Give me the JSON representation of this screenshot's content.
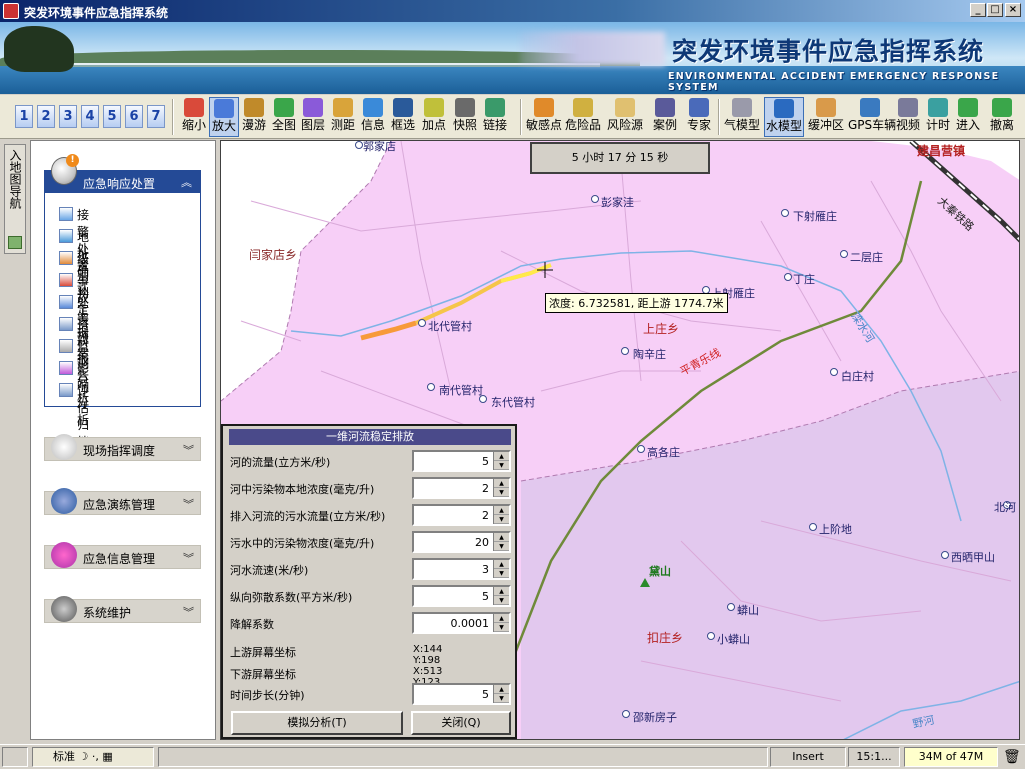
{
  "window": {
    "title": "突发环境事件应急指挥系统"
  },
  "banner": {
    "title": "突发环境事件应急指挥系统",
    "subtitle": "ENVIRONMENTAL ACCIDENT EMERGENCY RESPONSE SYSTEM"
  },
  "toolbar": {
    "numbers": [
      "1",
      "2",
      "3",
      "4",
      "5",
      "6",
      "7"
    ],
    "tools": [
      "缩小",
      "放大",
      "漫游",
      "全图",
      "图层",
      "测距",
      "信息",
      "框选",
      "加点",
      "快照",
      "链接"
    ],
    "tools2": [
      "敏感点",
      "危险品",
      "风险源",
      "案例",
      "专家"
    ],
    "tools3": [
      "气模型",
      "水模型",
      "缓冲区",
      "GPS车辆",
      "视频",
      "计时",
      "进入",
      "撤离"
    ],
    "active": [
      "放大",
      "水模型"
    ]
  },
  "left_tab": {
    "label": "入地图导航"
  },
  "sidebar": {
    "response": {
      "title": "应急响应处置",
      "items": [
        "接警处置",
        "地址确认",
        "级别判定",
        "事故上报",
        "处置预案",
        "资料报告",
        "监测分析",
        "影响分析",
        "评估归档"
      ]
    },
    "sections": [
      "现场指挥调度",
      "应急演练管理",
      "应急信息管理",
      "系统维护"
    ]
  },
  "map": {
    "timer": "5 小时 17 分 15 秒",
    "tooltip": "浓度: 6.732581, 距上游 1774.7米",
    "places": [
      "郭家店",
      "彭家洼",
      "下射雁庄",
      "二层庄",
      "丁庄",
      "上射雁庄",
      "闫家店乡",
      "北代管村",
      "上庄乡",
      "陶辛庄",
      "南代管村",
      "东代管村",
      "白庄村",
      "高各庄",
      "上阶地",
      "西晒甲山",
      "北河",
      "黛山",
      "蟒山",
      "小蟒山",
      "扣庄乡",
      "邵新房子",
      "建昌营镇",
      "大秦铁路",
      "平青乐线",
      "滦水河",
      "野河"
    ]
  },
  "dialog": {
    "title": "一维河流稳定排放",
    "fields": [
      {
        "label": "河的流量(立方米/秒)",
        "value": "5"
      },
      {
        "label": "河中污染物本地浓度(毫克/升)",
        "value": "2"
      },
      {
        "label": "排入河流的污水流量(立方米/秒)",
        "value": "2"
      },
      {
        "label": "污水中的污染物浓度(毫克/升)",
        "value": "20"
      },
      {
        "label": "河水流速(米/秒)",
        "value": "3"
      },
      {
        "label": "纵向弥散系数(平方米/秒)",
        "value": "5"
      },
      {
        "label": "降解系数",
        "value": "0.0001"
      }
    ],
    "upstream": {
      "label": "上游屏幕坐标",
      "value": "X:144 Y:198"
    },
    "downstream": {
      "label": "下游屏幕坐标",
      "value": "X:513 Y:123"
    },
    "timestep": {
      "label": "时间步长(分钟)",
      "value": "5"
    },
    "analyze_button": "模拟分析(T)",
    "close_button": "关闭(Q)"
  },
  "statusbar": {
    "ime": "标准",
    "insert": "Insert",
    "pos": "15:1...",
    "memory": "34M of 47M"
  }
}
